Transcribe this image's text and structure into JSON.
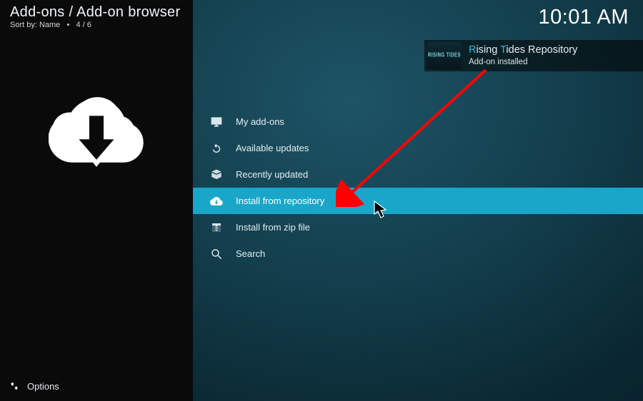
{
  "header": {
    "breadcrumb": "Add-ons / Add-on browser",
    "sort_label": "Sort by: Name",
    "position": "4 / 6",
    "clock": "10:01 AM"
  },
  "menu": {
    "items": [
      {
        "id": "my-addons",
        "label": "My add-ons",
        "selected": false
      },
      {
        "id": "available-updates",
        "label": "Available updates",
        "selected": false
      },
      {
        "id": "recently-updated",
        "label": "Recently updated",
        "selected": false
      },
      {
        "id": "install-from-repository",
        "label": "Install from repository",
        "selected": true
      },
      {
        "id": "install-from-zip",
        "label": "Install from zip file",
        "selected": false
      },
      {
        "id": "search",
        "label": "Search",
        "selected": false
      }
    ]
  },
  "footer": {
    "options_label": "Options"
  },
  "notification": {
    "thumb_text": "RISING TIDES",
    "title_prefix_hl1": "R",
    "title_mid1": "ising ",
    "title_prefix_hl2": "T",
    "title_mid2": "ides",
    "title_rest": " Repository",
    "subtitle": "Add-on installed"
  },
  "colors": {
    "accent": "#1aa6c9",
    "highlight_letter": "#2bb7e0",
    "annotation": "#ff0000"
  }
}
